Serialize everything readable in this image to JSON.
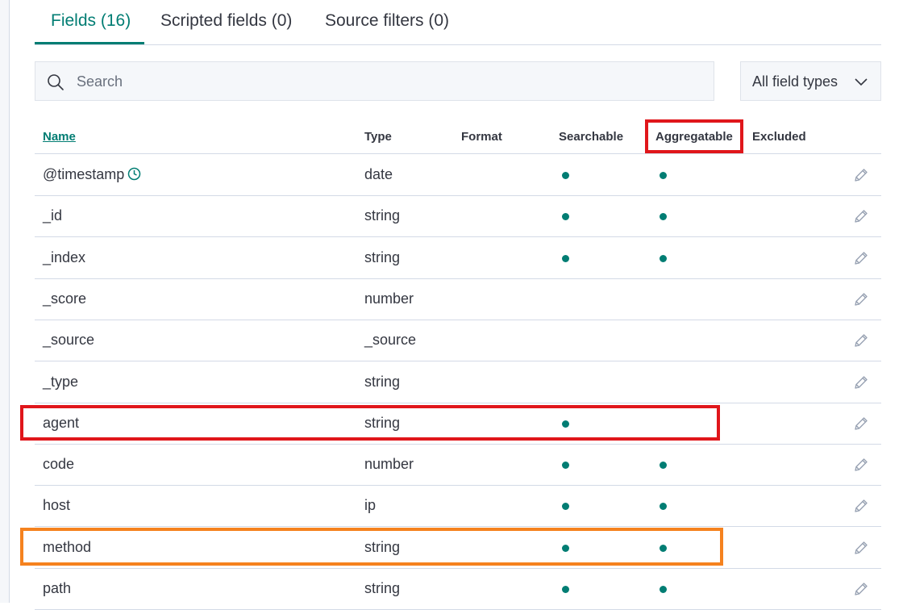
{
  "tabs": [
    {
      "label": "Fields (16)",
      "active": true
    },
    {
      "label": "Scripted fields (0)",
      "active": false
    },
    {
      "label": "Source filters (0)",
      "active": false
    }
  ],
  "search": {
    "placeholder": "Search",
    "value": ""
  },
  "type_filter": {
    "selected": "All field types"
  },
  "columns": {
    "name": "Name",
    "type": "Type",
    "format": "Format",
    "searchable": "Searchable",
    "aggregatable": "Aggregatable",
    "excluded": "Excluded"
  },
  "rows": [
    {
      "name": "@timestamp",
      "type": "date",
      "searchable": true,
      "aggregatable": true,
      "time_field": true
    },
    {
      "name": "_id",
      "type": "string",
      "searchable": true,
      "aggregatable": true
    },
    {
      "name": "_index",
      "type": "string",
      "searchable": true,
      "aggregatable": true
    },
    {
      "name": "_score",
      "type": "number",
      "searchable": false,
      "aggregatable": false
    },
    {
      "name": "_source",
      "type": "_source",
      "searchable": false,
      "aggregatable": false
    },
    {
      "name": "_type",
      "type": "string",
      "searchable": false,
      "aggregatable": false
    },
    {
      "name": "agent",
      "type": "string",
      "searchable": true,
      "aggregatable": false
    },
    {
      "name": "code",
      "type": "number",
      "searchable": true,
      "aggregatable": true
    },
    {
      "name": "host",
      "type": "ip",
      "searchable": true,
      "aggregatable": true
    },
    {
      "name": "method",
      "type": "string",
      "searchable": true,
      "aggregatable": true
    },
    {
      "name": "path",
      "type": "string",
      "searchable": true,
      "aggregatable": true
    }
  ],
  "colors": {
    "accent": "#017d73",
    "highlight_red": "#e0161b",
    "highlight_orange": "#f5821f"
  }
}
